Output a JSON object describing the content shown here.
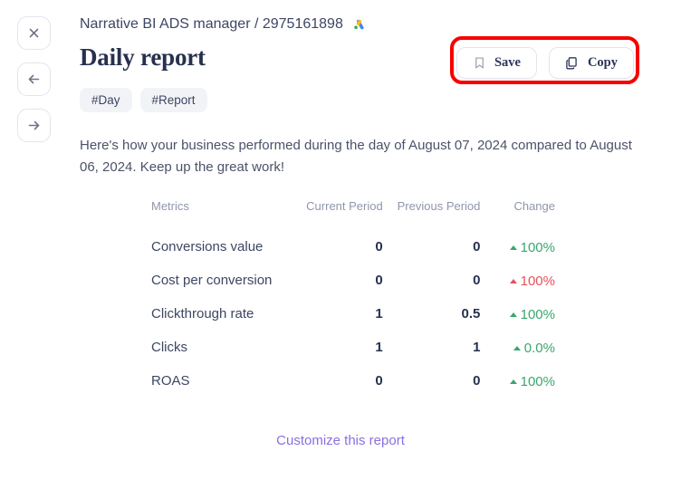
{
  "rail": {
    "buttons": [
      {
        "name": "close-button",
        "icon": "close-icon"
      },
      {
        "name": "back-button",
        "icon": "arrow-left-icon"
      },
      {
        "name": "forward-button",
        "icon": "arrow-right-icon"
      }
    ]
  },
  "header": {
    "breadcrumb": "Narrative BI ADS manager / 2975161898",
    "account_icon": "google-ads-icon",
    "title": "Daily report",
    "tags": [
      "#Day",
      "#Report"
    ]
  },
  "toolbar": {
    "save_label": "Save",
    "save_icon": "bookmark-icon",
    "copy_label": "Copy",
    "copy_icon": "copy-icon",
    "highlight_color": "#f60000"
  },
  "summary": "Here's how your business performed during the day of August 07, 2024 compared to August 06, 2024. Keep up the great work!",
  "table": {
    "headers": [
      "Metrics",
      "Current Period",
      "Previous Period",
      "Change"
    ],
    "rows": [
      {
        "metric": "Conversions value",
        "current": "0",
        "previous": "0",
        "change": "100%",
        "direction": "up",
        "trend": "positive"
      },
      {
        "metric": "Cost per conversion",
        "current": "0",
        "previous": "0",
        "change": "100%",
        "direction": "up",
        "trend": "negative"
      },
      {
        "metric": "Clickthrough rate",
        "current": "1",
        "previous": "0.5",
        "change": "100%",
        "direction": "up",
        "trend": "positive"
      },
      {
        "metric": "Clicks",
        "current": "1",
        "previous": "1",
        "change": "0.0%",
        "direction": "up",
        "trend": "positive"
      },
      {
        "metric": "ROAS",
        "current": "0",
        "previous": "0",
        "change": "100%",
        "direction": "up",
        "trend": "positive"
      }
    ]
  },
  "footer": {
    "customize_label": "Customize this report",
    "link_color": "#8b6fe0"
  },
  "colors": {
    "positive": "#3aa76d",
    "negative": "#e8505b",
    "title": "#27314f",
    "muted": "#9097ab"
  }
}
